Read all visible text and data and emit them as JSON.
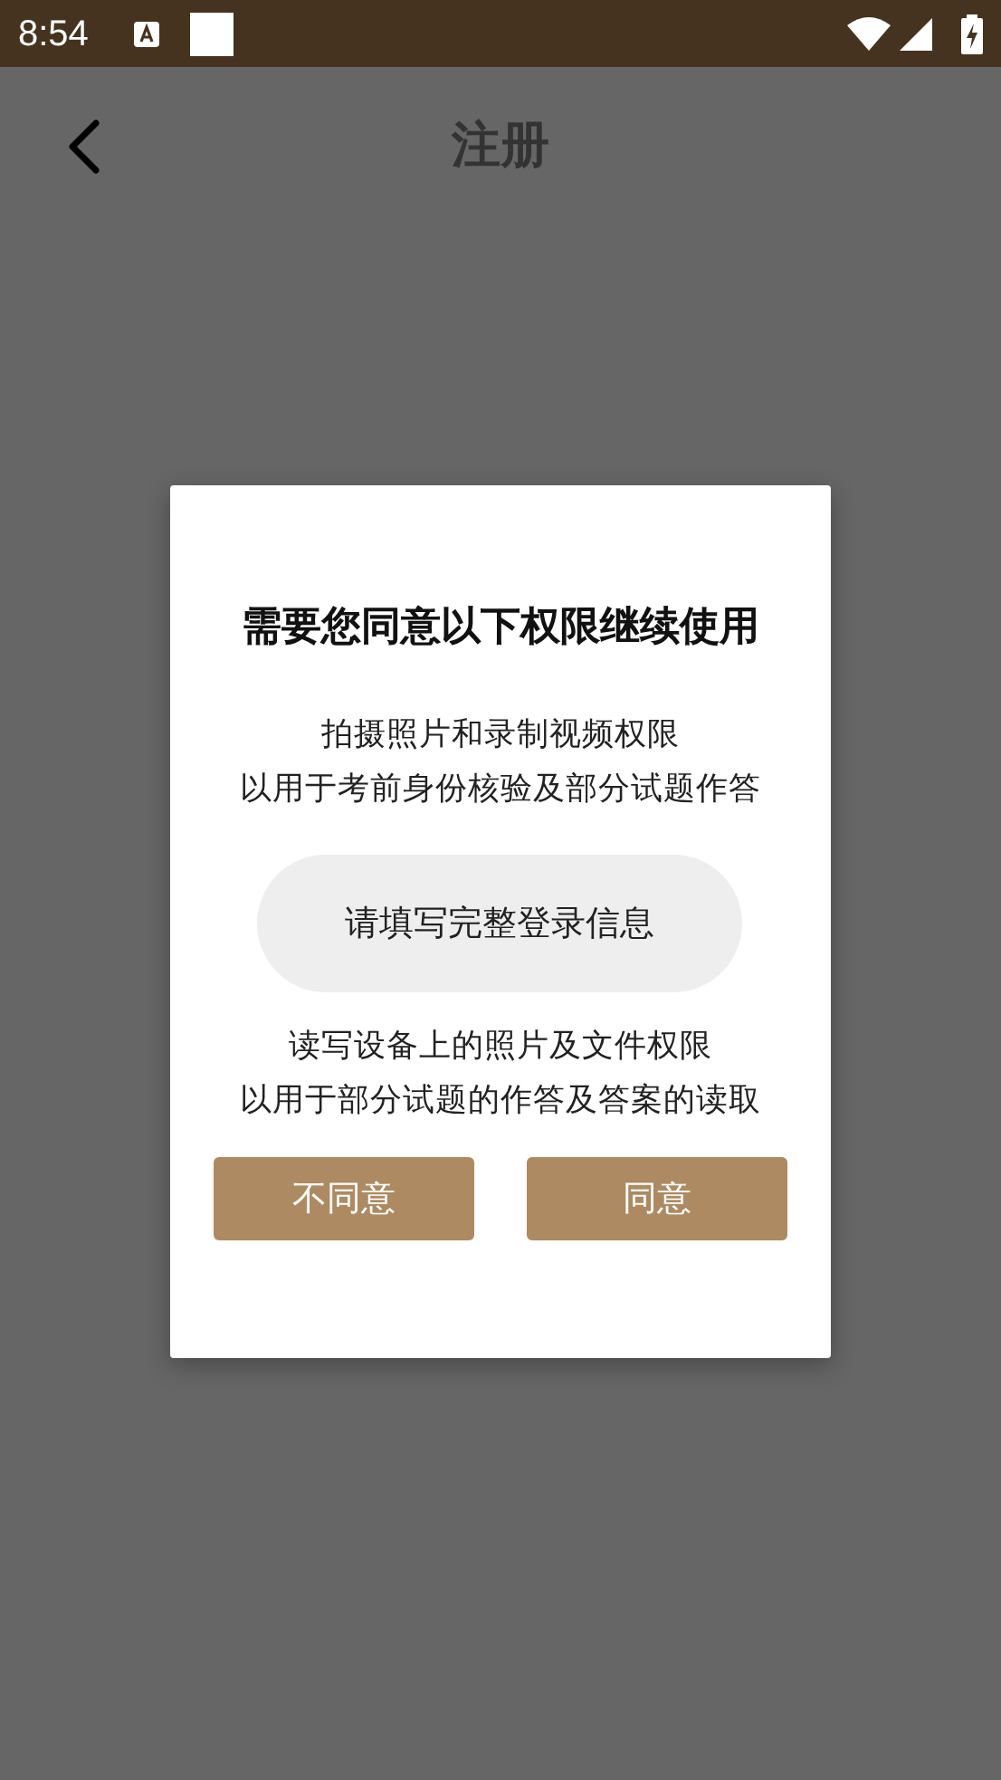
{
  "status_bar": {
    "time": "8:54"
  },
  "header": {
    "title": "注册"
  },
  "dialog": {
    "title": "需要您同意以下权限继续使用",
    "permissions": [
      {
        "name": "拍摄照片和录制视频权限",
        "purpose": "以用于考前身份核验及部分试题作答"
      },
      {
        "name": "读写设备上的照片及文件权限",
        "purpose": "以用于部分试题的作答及答案的读取"
      }
    ],
    "buttons": [
      "不同意",
      "同意"
    ]
  },
  "toast": {
    "text": "请填写完整登录信息"
  }
}
